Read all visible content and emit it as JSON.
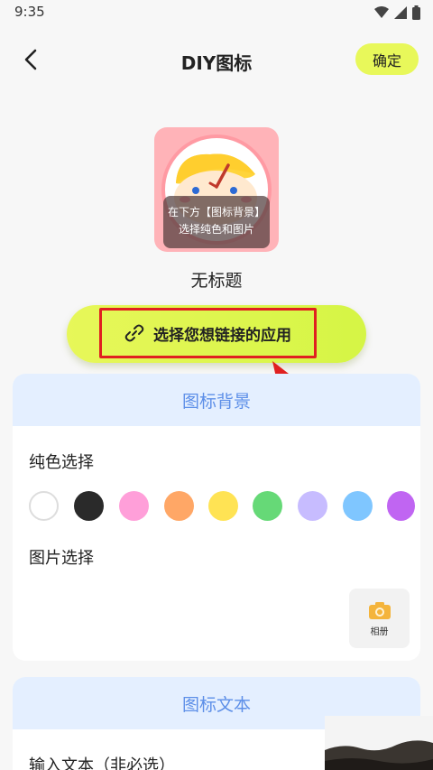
{
  "status_bar": {
    "time": "9:35"
  },
  "header": {
    "title": "DIY图标",
    "confirm_label": "确定"
  },
  "preview": {
    "hint_line1": "在下方【图标背景】",
    "hint_line2": "选择纯色和图片",
    "name": "无标题"
  },
  "link_app": {
    "label": "选择您想链接的应用"
  },
  "background_section": {
    "title": "图标背景",
    "solid_label": "纯色选择",
    "colors": [
      "#ffffff",
      "#2a2a2a",
      "#ff9fd9",
      "#ffa766",
      "#ffe354",
      "#66d977",
      "#c7bcff",
      "#7fc6ff",
      "#c065f2"
    ],
    "image_label": "图片选择",
    "album_label": "相册"
  },
  "text_section": {
    "title": "图标文本",
    "input_label": "输入文本（非必选）"
  },
  "colors": {
    "accent": "#e8f85a",
    "section_header_bg": "#e4efff",
    "section_header_text": "#5d8fe8",
    "annotation_red": "#e02020"
  }
}
